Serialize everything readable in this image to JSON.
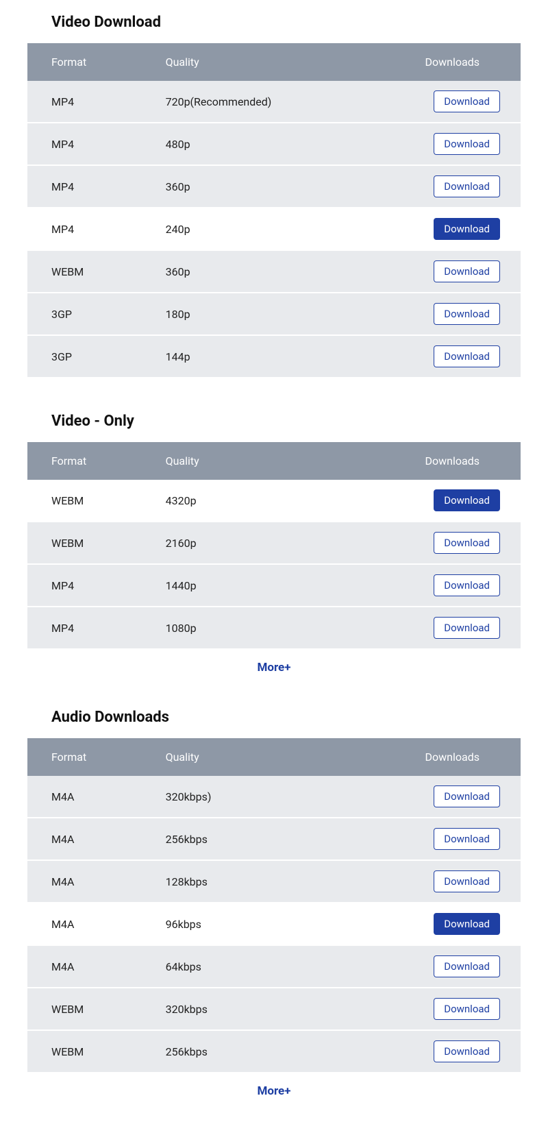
{
  "sections": [
    {
      "title": "Video Download",
      "headers": {
        "format": "Format",
        "quality": "Quality",
        "downloads": "Downloads"
      },
      "rows": [
        {
          "format": "MP4",
          "quality": "720p(Recommended)",
          "button": "Download",
          "highlighted": false
        },
        {
          "format": "MP4",
          "quality": "480p",
          "button": "Download",
          "highlighted": false
        },
        {
          "format": "MP4",
          "quality": "360p",
          "button": "Download",
          "highlighted": false
        },
        {
          "format": "MP4",
          "quality": "240p",
          "button": "Download",
          "highlighted": true
        },
        {
          "format": "WEBM",
          "quality": "360p",
          "button": "Download",
          "highlighted": false
        },
        {
          "format": "3GP",
          "quality": "180p",
          "button": "Download",
          "highlighted": false
        },
        {
          "format": "3GP",
          "quality": "144p",
          "button": "Download",
          "highlighted": false
        }
      ],
      "more": null
    },
    {
      "title": "Video - Only",
      "headers": {
        "format": "Format",
        "quality": "Quality",
        "downloads": "Downloads"
      },
      "rows": [
        {
          "format": "WEBM",
          "quality": "4320p",
          "button": "Download",
          "highlighted": true
        },
        {
          "format": "WEBM",
          "quality": "2160p",
          "button": "Download",
          "highlighted": false
        },
        {
          "format": "MP4",
          "quality": "1440p",
          "button": "Download",
          "highlighted": false
        },
        {
          "format": "MP4",
          "quality": "1080p",
          "button": "Download",
          "highlighted": false
        }
      ],
      "more": "More+"
    },
    {
      "title": "Audio Downloads",
      "headers": {
        "format": "Format",
        "quality": "Quality",
        "downloads": "Downloads"
      },
      "rows": [
        {
          "format": "M4A",
          "quality": "320kbps)",
          "button": "Download",
          "highlighted": false
        },
        {
          "format": "M4A",
          "quality": "256kbps",
          "button": "Download",
          "highlighted": false
        },
        {
          "format": "M4A",
          "quality": "128kbps",
          "button": "Download",
          "highlighted": false
        },
        {
          "format": "M4A",
          "quality": "96kbps",
          "button": "Download",
          "highlighted": true
        },
        {
          "format": "M4A",
          "quality": "64kbps",
          "button": "Download",
          "highlighted": false
        },
        {
          "format": "WEBM",
          "quality": "320kbps",
          "button": "Download",
          "highlighted": false
        },
        {
          "format": "WEBM",
          "quality": "256kbps",
          "button": "Download",
          "highlighted": false
        }
      ],
      "more": "More+"
    }
  ]
}
